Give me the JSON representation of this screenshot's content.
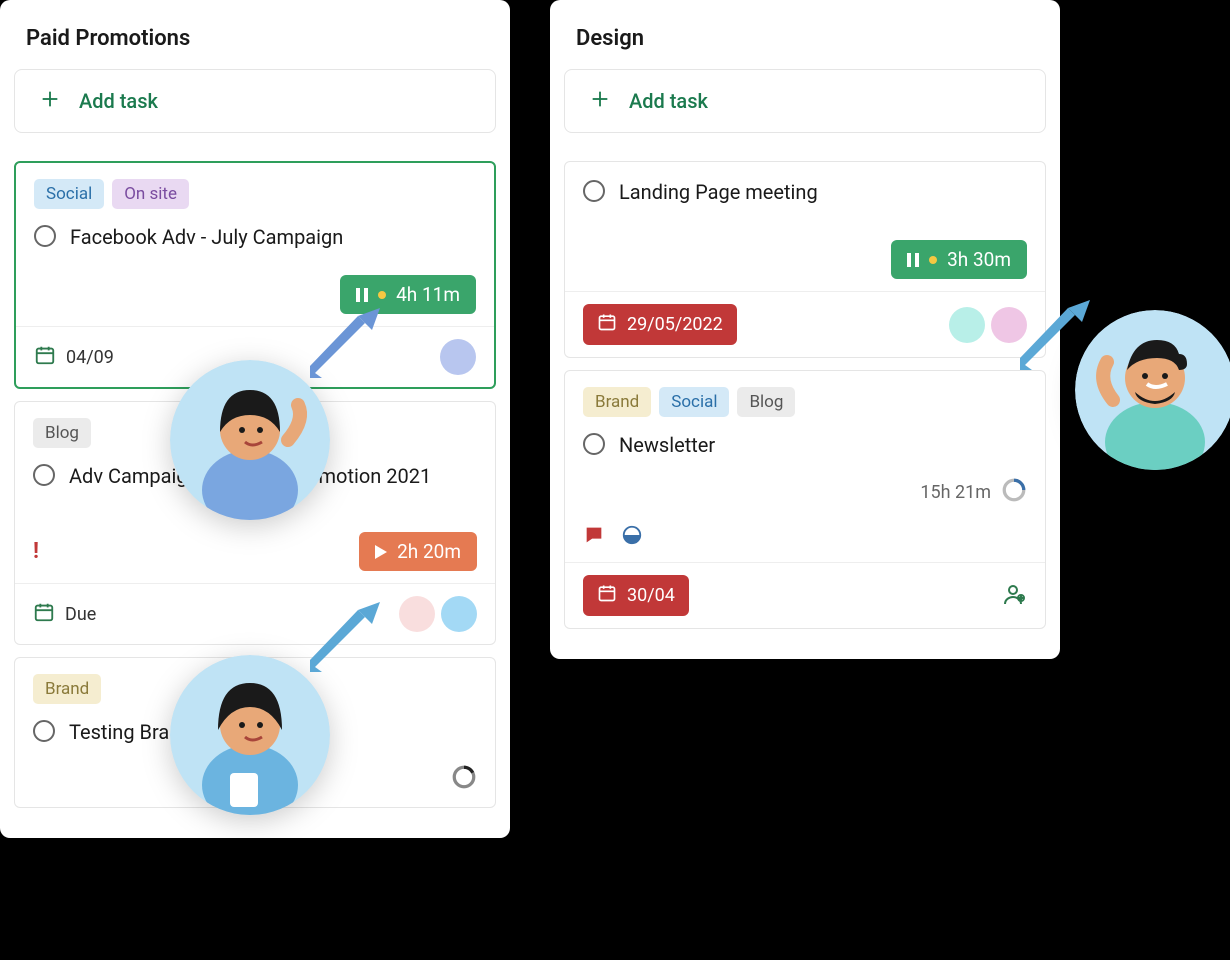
{
  "columns": [
    {
      "title": "Paid Promotions",
      "add_label": "Add task",
      "cards": [
        {
          "tags": [
            {
              "label": "Social",
              "cls": "tag-social"
            },
            {
              "label": "On site",
              "cls": "tag-onsite"
            }
          ],
          "title": "Facebook Adv - July Campaign",
          "timer": {
            "label": "4h 11m",
            "state": "pause"
          },
          "date": "04/09",
          "avatars": [
            "#b8c6ef"
          ]
        },
        {
          "tags": [
            {
              "label": "Blog",
              "cls": "tag-blog"
            }
          ],
          "title": "Adv Campaign - Content promotion 2021",
          "priority": true,
          "timer": {
            "label": "2h 20m",
            "state": "play"
          },
          "due_label": "Due",
          "avatars": [
            "#f9dede",
            "#a3d9f5"
          ]
        },
        {
          "tags": [
            {
              "label": "Brand",
              "cls": "tag-brand"
            }
          ],
          "title": "Testing Branded Content"
        }
      ]
    },
    {
      "title": "Design",
      "add_label": "Add task",
      "cards": [
        {
          "title": "Landing Page meeting",
          "timer": {
            "label": "3h 30m",
            "state": "pause"
          },
          "date": "29/05/2022",
          "avatars": [
            "#b8efe8",
            "#efc6e5"
          ]
        },
        {
          "tags": [
            {
              "label": "Brand",
              "cls": "tag-brand"
            },
            {
              "label": "Social",
              "cls": "tag-social"
            },
            {
              "label": "Blog",
              "cls": "tag-blog"
            }
          ],
          "title": "Newsletter",
          "duration": "15h 21m",
          "date": "30/04"
        }
      ]
    }
  ]
}
